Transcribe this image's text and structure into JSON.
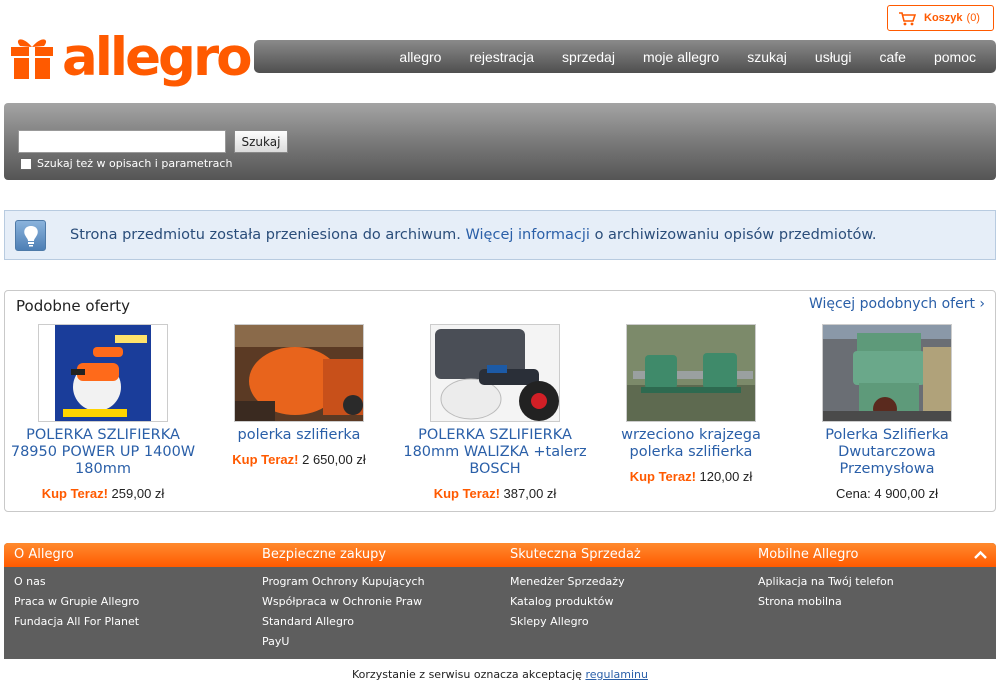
{
  "brand": {
    "name": "allegro",
    "color": "#ff5a00"
  },
  "cart": {
    "label": "Koszyk",
    "count": "(0)",
    "icon": "cart-icon"
  },
  "nav": [
    "allegro",
    "rejestracja",
    "sprzedaj",
    "moje allegro",
    "szukaj",
    "usługi",
    "cafe",
    "pomoc"
  ],
  "search": {
    "value": "",
    "button": "Szukaj",
    "checkbox_label": "Szukaj też w opisach i parametrach",
    "checked": false
  },
  "info": {
    "icon": "lightbulb-icon",
    "text_before": "Strona przedmiotu została przeniesiona do archiwum.",
    "link": "Więcej informacji",
    "text_after": "o archiwizowaniu opisów przedmiotów."
  },
  "similar": {
    "title": "Podobne oferty",
    "more": "Więcej podobnych ofert ›",
    "offers": [
      {
        "name": "POLERKA SZLIFIERKA 78950 POWER UP 1400W 180mm",
        "price_label": "Kup Teraz!",
        "price": "259,00 zł"
      },
      {
        "name": "polerka szlifierka",
        "price_label": "Kup Teraz!",
        "price": "2 650,00 zł"
      },
      {
        "name": "POLERKA SZLIFIERKA 180mm WALIZKA +talerz BOSCH",
        "price_label": "Kup Teraz!",
        "price": "387,00 zł"
      },
      {
        "name": "wrzeciono krajzega polerka szlifierka",
        "price_label": "Kup Teraz!",
        "price": "120,00 zł"
      },
      {
        "name": "Polerka Szlifierka Dwutarczowa Przemysłowa",
        "price_label": "Cena:",
        "price": "4 900,00 zł"
      }
    ]
  },
  "footer": {
    "columns": [
      {
        "title": "O Allegro",
        "links": [
          "O nas",
          "Praca w Grupie Allegro",
          "Fundacja All For Planet"
        ]
      },
      {
        "title": "Bezpieczne zakupy",
        "links": [
          "Program Ochrony Kupujących",
          "Współpraca w Ochronie Praw",
          "Standard Allegro",
          "PayU"
        ]
      },
      {
        "title": "Skuteczna Sprzedaż",
        "links": [
          "Menedżer Sprzedaży",
          "Katalog produktów",
          "Sklepy Allegro"
        ]
      },
      {
        "title": "Mobilne Allegro",
        "links": [
          "Aplikacja na Twój telefon",
          "Strona mobilna"
        ]
      }
    ]
  },
  "terms": {
    "text": "Korzystanie z serwisu oznacza akceptację",
    "link": "regulaminu"
  }
}
